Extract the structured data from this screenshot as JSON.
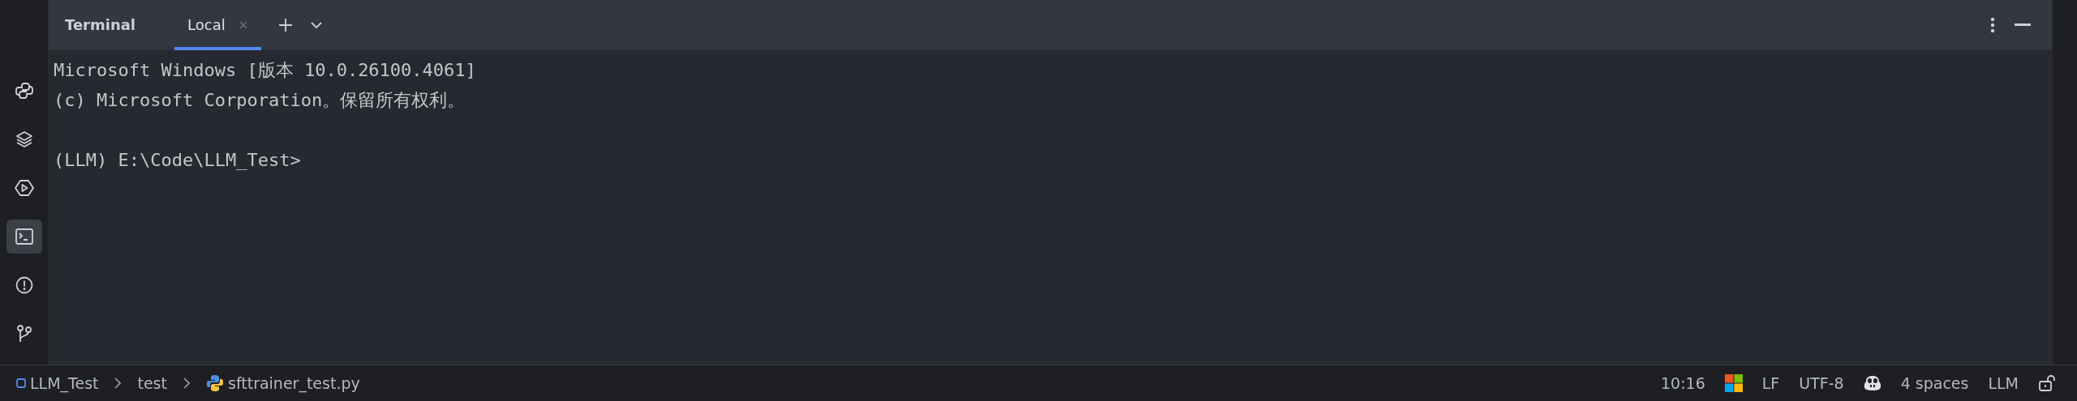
{
  "sidebar": {
    "tools": [
      {
        "kind": "python",
        "selected": false
      },
      {
        "kind": "layers",
        "selected": false
      },
      {
        "kind": "run",
        "selected": false
      },
      {
        "kind": "terminal",
        "selected": true
      },
      {
        "kind": "problems",
        "selected": false
      },
      {
        "kind": "git",
        "selected": false
      }
    ]
  },
  "header": {
    "title": "Terminal",
    "tabs": [
      {
        "label": "Local",
        "selected": true
      }
    ]
  },
  "terminal": {
    "output": [
      "Microsoft Windows [版本 10.0.26100.4061]",
      "(c) Microsoft Corporation。保留所有权利。"
    ],
    "prompt": "(LLM) E:\\Code\\LLM_Test>"
  },
  "status_bar": {
    "breadcrumbs": [
      {
        "kind": "project",
        "label": "LLM_Test"
      },
      {
        "kind": "folder",
        "label": "test"
      },
      {
        "kind": "python-file",
        "label": "sfttrainer_test.py"
      }
    ],
    "items": [
      {
        "kind": "text",
        "label": "10:16"
      },
      {
        "kind": "windows"
      },
      {
        "kind": "text",
        "label": "LF"
      },
      {
        "kind": "text",
        "label": "UTF-8"
      },
      {
        "kind": "copilot"
      },
      {
        "kind": "text",
        "label": "4 spaces"
      },
      {
        "kind": "text",
        "label": "LLM"
      },
      {
        "kind": "lock"
      }
    ]
  }
}
